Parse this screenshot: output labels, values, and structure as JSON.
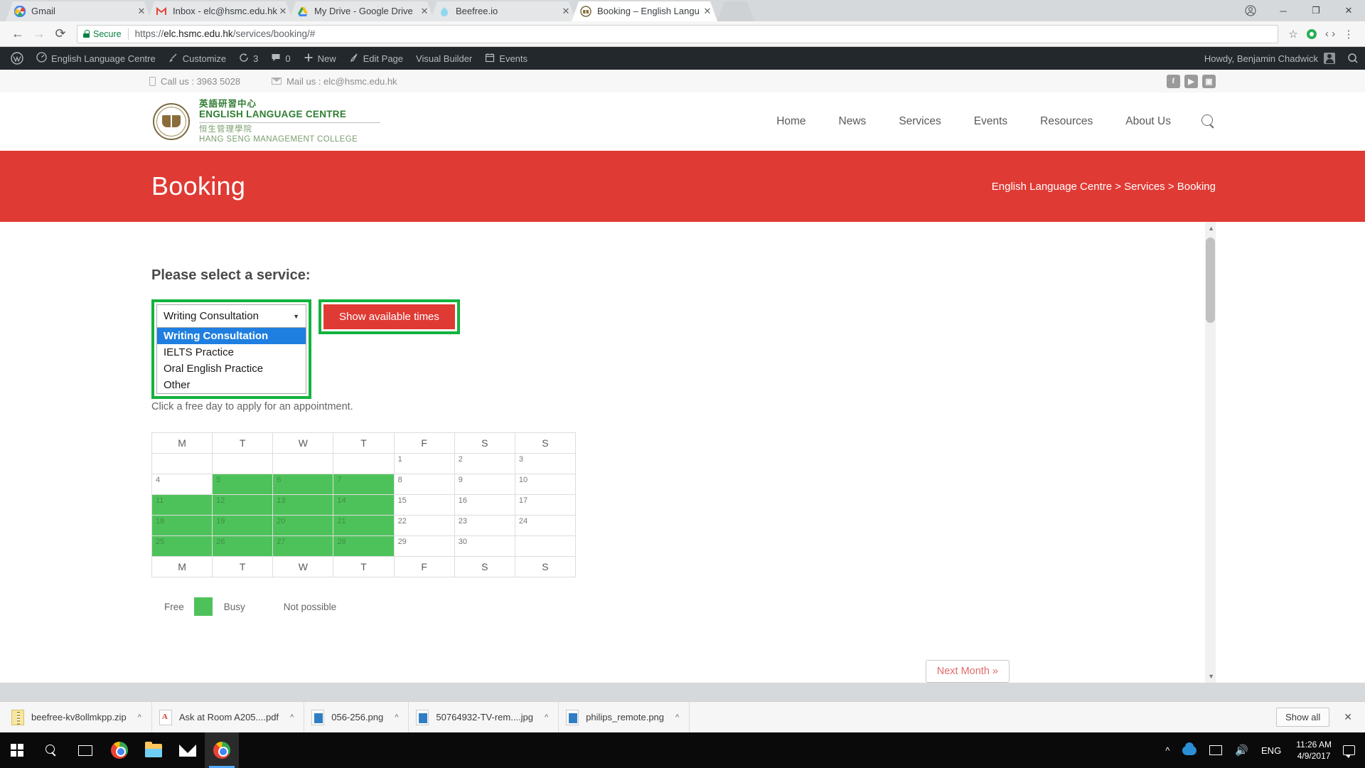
{
  "browser": {
    "tabs": [
      {
        "title": "Gmail",
        "favicon": "gmail-icon",
        "active": false
      },
      {
        "title": "Inbox - elc@hsmc.edu.hk",
        "favicon": "gmail-m-icon",
        "active": false
      },
      {
        "title": "My Drive - Google Drive",
        "favicon": "google-drive-icon",
        "active": false
      },
      {
        "title": "Beefree.io",
        "favicon": "beefree-icon",
        "active": false
      },
      {
        "title": "Booking – English Langu",
        "favicon": "site-crest-icon",
        "active": true
      }
    ],
    "tab_close_label": "✕",
    "window_controls": {
      "minimize": "─",
      "maximize": "❐",
      "close": "✕",
      "profile": "●"
    },
    "toolbar": {
      "back": "←",
      "forward": "→",
      "reload": "⟳",
      "secure_label": "Secure",
      "url_scheme": "https://",
      "url_host": "elc.hsmc.edu.hk",
      "url_path": "/services/booking/#",
      "star": "☆",
      "extension": "●",
      "menu": "⋮"
    }
  },
  "wp_admin_bar": {
    "logo": "wordpress-icon",
    "items": [
      {
        "label": "English Language Centre",
        "icon": "dashboard-icon"
      },
      {
        "label": "Customize",
        "icon": "brush-icon"
      },
      {
        "label": "3",
        "icon": "updates-icon"
      },
      {
        "label": "0",
        "icon": "comments-icon"
      },
      {
        "label": "New",
        "icon": "plus-icon"
      },
      {
        "label": "Edit Page",
        "icon": "pencil-icon"
      },
      {
        "label": "Visual Builder",
        "icon": ""
      },
      {
        "label": "Events",
        "icon": "calendar-icon"
      }
    ],
    "howdy": "Howdy, Benjamin Chadwick",
    "search": "search-icon"
  },
  "site_topbar": {
    "phone_label": "Call us : 3963 5028",
    "mail_label": "Mail us : elc@hsmc.edu.hk",
    "social": [
      {
        "name": "facebook-icon",
        "glyph": "f"
      },
      {
        "name": "youtube-icon",
        "glyph": "▶"
      },
      {
        "name": "instagram-icon",
        "glyph": "▣"
      }
    ]
  },
  "logo": {
    "cn_line1": "英語研習中心",
    "en_line1": "ENGLISH LANGUAGE CENTRE",
    "cn_line2": "恒生管理學院",
    "en_line2": "HANG SENG MANAGEMENT COLLEGE"
  },
  "nav": {
    "items": [
      "Home",
      "News",
      "Services",
      "Events",
      "Resources",
      "About Us"
    ],
    "search_icon": "search-icon"
  },
  "hero": {
    "title": "Booking",
    "breadcrumb": "English Language Centre > Services > Booking",
    "bg_color": "#e03a34"
  },
  "booking": {
    "heading": "Please select a service:",
    "select": {
      "value": "Writing Consultation",
      "caret": "▼",
      "options": [
        "Writing Consultation",
        "IELTS Practice",
        "Oral English Practice",
        "Other"
      ],
      "selected_index": 0,
      "highlight_color": "#12b33e"
    },
    "show_times_button": "Show available times",
    "hint": "Click a free day to apply for an appointment.",
    "next_month_button": "Next Month »"
  },
  "calendar": {
    "day_headers": [
      "M",
      "T",
      "W",
      "T",
      "F",
      "S",
      "S"
    ],
    "weeks": [
      [
        {
          "day": "",
          "state": "blank"
        },
        {
          "day": "",
          "state": "blank"
        },
        {
          "day": "",
          "state": "blank"
        },
        {
          "day": "",
          "state": "blank"
        },
        {
          "day": "1",
          "state": "free"
        },
        {
          "day": "2",
          "state": "free"
        },
        {
          "day": "3",
          "state": "free"
        }
      ],
      [
        {
          "day": "4",
          "state": "free"
        },
        {
          "day": "5",
          "state": "busy"
        },
        {
          "day": "6",
          "state": "busy"
        },
        {
          "day": "7",
          "state": "busy"
        },
        {
          "day": "8",
          "state": "free"
        },
        {
          "day": "9",
          "state": "free"
        },
        {
          "day": "10",
          "state": "free"
        }
      ],
      [
        {
          "day": "11",
          "state": "busy"
        },
        {
          "day": "12",
          "state": "busy"
        },
        {
          "day": "13",
          "state": "busy"
        },
        {
          "day": "14",
          "state": "busy"
        },
        {
          "day": "15",
          "state": "free"
        },
        {
          "day": "16",
          "state": "free"
        },
        {
          "day": "17",
          "state": "free"
        }
      ],
      [
        {
          "day": "18",
          "state": "busy"
        },
        {
          "day": "19",
          "state": "busy"
        },
        {
          "day": "20",
          "state": "busy"
        },
        {
          "day": "21",
          "state": "busy"
        },
        {
          "day": "22",
          "state": "free"
        },
        {
          "day": "23",
          "state": "free"
        },
        {
          "day": "24",
          "state": "free"
        }
      ],
      [
        {
          "day": "25",
          "state": "busy"
        },
        {
          "day": "26",
          "state": "busy"
        },
        {
          "day": "27",
          "state": "busy"
        },
        {
          "day": "28",
          "state": "busy"
        },
        {
          "day": "29",
          "state": "free"
        },
        {
          "day": "30",
          "state": "free"
        },
        {
          "day": "",
          "state": "blank"
        }
      ]
    ],
    "legend": {
      "free_label": "Free",
      "busy_label": "Busy",
      "not_possible_label": "Not possible",
      "busy_color": "#4ec25a"
    }
  },
  "download_shelf": {
    "items": [
      {
        "name": "beefree-kv8ollmkpp.zip",
        "icon": "zip-file-icon"
      },
      {
        "name": "Ask at Room A205....pdf",
        "icon": "pdf-file-icon"
      },
      {
        "name": "056-256.png",
        "icon": "image-file-icon"
      },
      {
        "name": "50764932-TV-rem....jpg",
        "icon": "image-file-icon"
      },
      {
        "name": "philips_remote.png",
        "icon": "image-file-icon"
      }
    ],
    "caret": "^",
    "show_all": "Show all",
    "close": "✕"
  },
  "taskbar": {
    "start": "windows-start-icon",
    "search": "search-icon",
    "task_view": "task-view-icon",
    "pinned": [
      "chrome-icon",
      "file-explorer-icon",
      "mail-icon"
    ],
    "active_app": "chrome-icon",
    "tray": {
      "chevron": "^",
      "onedrive": "onedrive-icon",
      "network": "network-icon",
      "volume": "🔊",
      "language": "ENG",
      "time": "11:26 AM",
      "date": "4/9/2017",
      "notifications": "action-center-icon"
    }
  }
}
